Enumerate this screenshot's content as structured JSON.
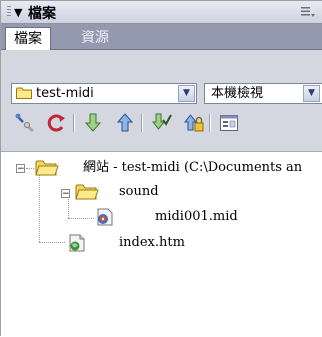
{
  "panel": {
    "title": "檔案",
    "collapse_icon": "triangle-down-icon",
    "options_icon": "panel-options-icon"
  },
  "tabs": [
    {
      "label": "檔案",
      "active": true
    },
    {
      "label": "資源",
      "active": false
    }
  ],
  "site_select": {
    "value": "test-midi",
    "icon": "folder-icon"
  },
  "view_select": {
    "value": "本機檢視"
  },
  "toolbar_icons": [
    "connect-icon",
    "refresh-icon",
    "get-files-icon",
    "put-files-icon",
    "check-out-icon",
    "check-in-icon",
    "expand-icon"
  ],
  "tree": {
    "root": {
      "label": "網站 - test-midi (C:\\Documents an"
    },
    "folder": {
      "label": "sound"
    },
    "file_midi": {
      "label": "midi001.mid"
    },
    "file_html": {
      "label": "index.htm"
    }
  },
  "colors": {
    "tab_bar": "#939ab0",
    "toolbar_bg": "#d4d7e0",
    "folder_yellow": "#f3d75a"
  }
}
